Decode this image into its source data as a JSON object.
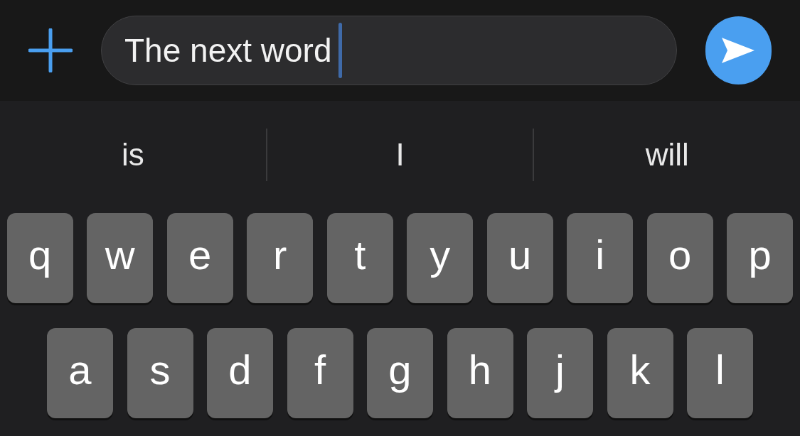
{
  "composer": {
    "value": "The next word"
  },
  "suggestions": [
    "is",
    "I",
    "will"
  ],
  "keyboard_rows": [
    [
      "q",
      "w",
      "e",
      "r",
      "t",
      "y",
      "u",
      "i",
      "o",
      "p"
    ],
    [
      "a",
      "s",
      "d",
      "f",
      "g",
      "h",
      "j",
      "k",
      "l"
    ]
  ]
}
